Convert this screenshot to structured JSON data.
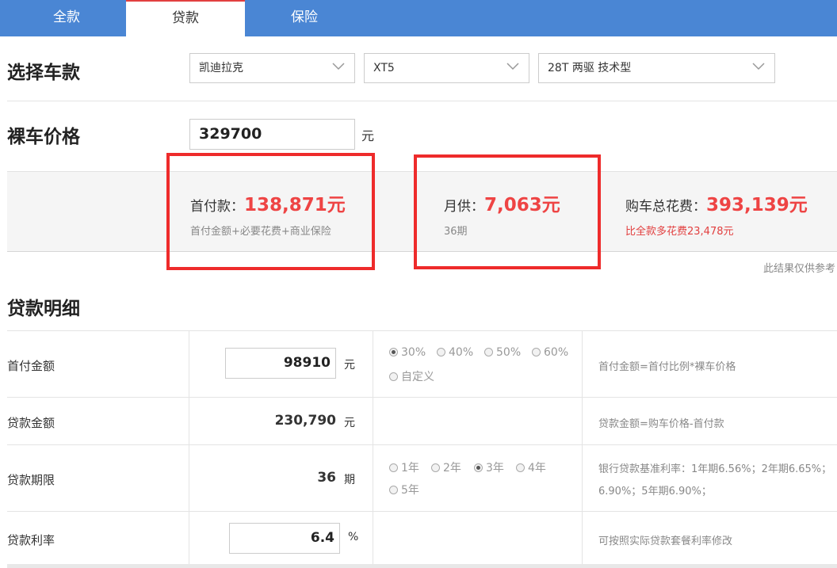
{
  "tabs": [
    {
      "label": "全款",
      "active": false
    },
    {
      "label": "贷款",
      "active": true
    },
    {
      "label": "保险",
      "active": false
    }
  ],
  "select_car": {
    "title": "选择车款",
    "brand": "凯迪拉克",
    "model": "XT5",
    "trim": "28T 两驱 技术型"
  },
  "price": {
    "title": "裸车价格",
    "value": "329700",
    "unit": "元"
  },
  "summary": {
    "down_label": "首付款：",
    "down_value": "138,871元",
    "down_sub": "首付金额+必要花费+商业保险",
    "monthly_label": "月供：",
    "monthly_value": "7,063元",
    "monthly_sub": "36期",
    "total_label": "购车总花费：",
    "total_value": "393,139元",
    "total_sub": "比全款多花费23,478元",
    "note": "此结果仅供参考",
    "highlight_color": "#ee2b2b"
  },
  "details": {
    "title": "贷款明细",
    "down_payment": {
      "label": "首付金额",
      "value": "98910",
      "unit": "元",
      "options": [
        "30%",
        "40%",
        "50%",
        "60%",
        "自定义"
      ],
      "selected": "30%",
      "formula": "首付金额=首付比例*裸车价格"
    },
    "loan_amount": {
      "label": "贷款金额",
      "value": "230,790",
      "unit": "元",
      "formula": "贷款金额=购车价格-首付款"
    },
    "loan_term": {
      "label": "贷款期限",
      "value": "36",
      "unit": "期",
      "options": [
        "1年",
        "2年",
        "3年",
        "4年",
        "5年"
      ],
      "selected": "3年",
      "formula_line1": "银行贷款基准利率：1年期6.56%；2年期6.65%；",
      "formula_line2": "6.90%；5年期6.90%；"
    },
    "interest_rate": {
      "label": "贷款利率",
      "value": "6.4",
      "unit": "%",
      "formula": "可按照实际贷款套餐利率修改"
    }
  },
  "colors": {
    "tab_bar": "#4a86d4",
    "accent_red": "#ee4444"
  }
}
